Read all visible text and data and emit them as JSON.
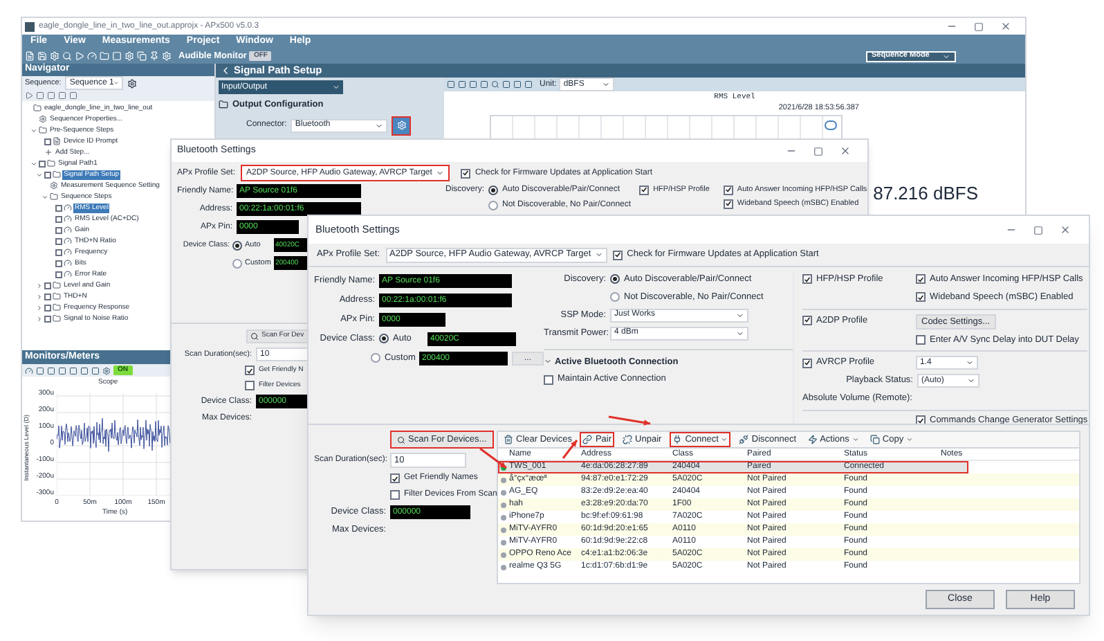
{
  "app": {
    "title": "eagle_dongle_line_in_two_line_out.approjx - APx500 v5.0.3",
    "menu": [
      "File",
      "View",
      "Measurements",
      "Project",
      "Window",
      "Help"
    ],
    "audible_monitor": {
      "label": "Audible Monitor",
      "state": "OFF",
      "on": false
    },
    "mode": "Sequence Mode"
  },
  "navigator": {
    "title": "Navigator",
    "sequence_label": "Sequence:",
    "sequence": "Sequence 1",
    "tree": [
      {
        "label": "eagle_dongle_line_in_two_line_out",
        "kind": "project",
        "selected": false,
        "children": [
          {
            "label": "Sequencer Properties...",
            "kind": "settings",
            "selected": false
          },
          {
            "label": "Pre-Sequence Steps",
            "kind": "folder",
            "selected": false,
            "expanded": true,
            "children": [
              {
                "label": "Device ID Prompt",
                "kind": "prompt",
                "selected": false,
                "checked": false
              },
              {
                "label": "Add Step...",
                "kind": "add",
                "selected": false
              }
            ]
          },
          {
            "label": "Signal Path1",
            "kind": "folder",
            "selected": false,
            "expanded": true,
            "checked": false,
            "children": [
              {
                "label": "Signal Path Setup",
                "kind": "folder",
                "selected": true,
                "expanded": true,
                "checked": false,
                "children": [
                  {
                    "label": "Measurement Sequence Setting",
                    "kind": "settings",
                    "selected": false
                  },
                  {
                    "label": "Sequence Steps",
                    "kind": "folder",
                    "selected": false,
                    "expanded": true,
                    "children": [
                      {
                        "label": "RMS Level",
                        "kind": "meter",
                        "selected": true,
                        "checked": false
                      },
                      {
                        "label": "RMS Level (AC+DC)",
                        "kind": "meter",
                        "selected": false,
                        "checked": false
                      },
                      {
                        "label": "Gain",
                        "kind": "meter",
                        "selected": false,
                        "checked": false
                      },
                      {
                        "label": "THD+N Ratio",
                        "kind": "meter",
                        "selected": false,
                        "checked": false
                      },
                      {
                        "label": "Frequency",
                        "kind": "meter",
                        "selected": false,
                        "checked": false
                      },
                      {
                        "label": "Bits",
                        "kind": "meter",
                        "selected": false,
                        "checked": false
                      },
                      {
                        "label": "Error Rate",
                        "kind": "meter",
                        "selected": false,
                        "checked": false
                      }
                    ]
                  }
                ]
              },
              {
                "label": "Level and Gain",
                "kind": "folder",
                "selected": false,
                "expanded": false,
                "checked": false
              },
              {
                "label": "THD+N",
                "kind": "folder",
                "selected": false,
                "expanded": false,
                "checked": false
              },
              {
                "label": "Frequency Response",
                "kind": "folder",
                "selected": false,
                "expanded": false,
                "checked": false
              },
              {
                "label": "Signal to Noise Ratio",
                "kind": "folder",
                "selected": false,
                "expanded": false,
                "checked": false
              }
            ]
          }
        ]
      }
    ]
  },
  "monitors": {
    "title": "Monitors/Meters",
    "toggle": {
      "state": "ON",
      "on": true
    },
    "scope": {
      "title": "Scope",
      "ylabel": "Instantaneous Level (D)",
      "xlabel": "Time (s)",
      "yticks": [
        "300u",
        "200u",
        "100u",
        "0",
        "-100u",
        "-200u",
        "-300u"
      ],
      "xticks": [
        "0",
        "50m",
        "100m",
        "150m"
      ]
    }
  },
  "signal_path": {
    "title": "Signal Path Setup",
    "tab": "Input/Output",
    "section": "Output Configuration",
    "connector_label": "Connector:",
    "connector": "Bluetooth",
    "settings_annotated": true
  },
  "graph": {
    "unit_label": "Unit:",
    "unit": "dBFS",
    "title": "RMS Level",
    "timestamp": "2021/6/28 18:53:56.387",
    "reading": "87.216 dBFS"
  },
  "dialog_back": {
    "title": "Bluetooth Settings",
    "profile_label": "APx Profile Set:",
    "profile": "A2DP Source, HFP Audio Gateway, AVRCP Target",
    "profile_annotated": true,
    "firmware_check": {
      "label": "Check for Firmware Updates at Application Start",
      "checked": true
    },
    "fields": [
      {
        "label": "Friendly Name:",
        "value": "AP Source 01f6"
      },
      {
        "label": "Address:",
        "value": "00:22:1a:00:01:f6"
      },
      {
        "label": "APx Pin:",
        "value": "0000"
      }
    ],
    "device_class_label": "Device Class:",
    "device_class": [
      {
        "label": "Auto",
        "selected": true,
        "value": "40020C"
      },
      {
        "label": "Custom",
        "selected": false,
        "value": "200400"
      }
    ],
    "discovery_label": "Discovery:",
    "discovery": [
      {
        "label": "Auto Discoverable/Pair/Connect",
        "selected": true
      },
      {
        "label": "Not Discoverable, No Pair/Connect",
        "selected": false
      }
    ],
    "options": [
      {
        "label": "HFP/HSP Profile",
        "checked": true
      },
      {
        "label": "Auto Answer Incoming HFP/HSP Calls",
        "checked": true
      },
      {
        "label": "Wideband Speech (mSBC) Enabled",
        "checked": true
      }
    ],
    "scan_button": "Scan For Dev",
    "scan_duration_label": "Scan Duration(sec):",
    "scan_duration": "10",
    "scan_checks": [
      {
        "label": "Get Friendly N",
        "checked": true
      },
      {
        "label": "Filter Devices",
        "checked": false
      }
    ],
    "scan_class_label": "Device Class:",
    "scan_class": "000000",
    "max_devices_label": "Max Devices:"
  },
  "dialog_front": {
    "title": "Bluetooth Settings",
    "profile_label": "APx Profile Set:",
    "profile": "A2DP Source, HFP Audio Gateway, AVRCP Target",
    "firmware_check": {
      "label": "Check for Firmware Updates at Application Start",
      "checked": true
    },
    "fields": [
      {
        "label": "Friendly Name:",
        "value": "AP Source 01f6"
      },
      {
        "label": "Address:",
        "value": "00:22:1a:00:01:f6"
      },
      {
        "label": "APx Pin:",
        "value": "0000"
      }
    ],
    "device_class_label": "Device Class:",
    "device_class": [
      {
        "label": "Auto",
        "selected": true,
        "value": "40020C"
      },
      {
        "label": "Custom",
        "selected": false,
        "value": "200400"
      }
    ],
    "browse": "...",
    "discovery_label": "Discovery:",
    "discovery": [
      {
        "label": "Auto Discoverable/Pair/Connect",
        "selected": true
      },
      {
        "label": "Not Discoverable, No Pair/Connect",
        "selected": false
      }
    ],
    "ssp_label": "SSP Mode:",
    "ssp": "Just Works",
    "tx_label": "Transmit Power:",
    "tx": "4 dBm",
    "active_connection": {
      "title": "Active Bluetooth Connection",
      "expanded": true
    },
    "maintain": {
      "label": "Maintain Active Connection",
      "checked": false
    },
    "hfp": {
      "label": "HFP/HSP Profile",
      "checked": true
    },
    "auto_answer": {
      "label": "Auto Answer Incoming HFP/HSP Calls",
      "checked": true
    },
    "wideband": {
      "label": "Wideband Speech (mSBC) Enabled",
      "checked": true
    },
    "a2dp": {
      "label": "A2DP Profile",
      "checked": true
    },
    "codec_button": "Codec Settings...",
    "av_sync": {
      "label": "Enter A/V Sync Delay into DUT Delay",
      "checked": false
    },
    "avrcp": {
      "label": "AVRCP Profile",
      "checked": true
    },
    "avrcp_version": "1.4",
    "playback_label": "Playback Status:",
    "playback": "(Auto)",
    "absolute_volume_label": "Absolute Volume (Remote):",
    "commands_change": {
      "label": "Commands Change Generator Settings",
      "checked": true
    },
    "scan_button": {
      "label": "Scan For Devices...",
      "annotated": true
    },
    "scan_duration_label": "Scan Duration(sec):",
    "scan_duration": "10",
    "scan_checks": [
      {
        "label": "Get Friendly Names",
        "checked": true
      },
      {
        "label": "Filter Devices From Scan",
        "checked": false
      }
    ],
    "scan_class_label": "Device Class:",
    "scan_class": "000000",
    "max_devices_label": "Max Devices:",
    "toolbar": [
      {
        "label": "Clear Devices",
        "kind": "clear",
        "annotated": false,
        "menu": false
      },
      {
        "label": "Pair",
        "kind": "pair",
        "annotated": true,
        "menu": false
      },
      {
        "label": "Unpair",
        "kind": "unpair",
        "annotated": false,
        "menu": false
      },
      {
        "label": "Connect",
        "kind": "connect",
        "annotated": true,
        "menu": true
      },
      {
        "label": "Disconnect",
        "kind": "disconnect",
        "annotated": false,
        "menu": false
      },
      {
        "label": "Actions",
        "kind": "actions",
        "annotated": false,
        "menu": true
      },
      {
        "label": "Copy",
        "kind": "copy",
        "annotated": false,
        "menu": true
      }
    ],
    "table": {
      "columns": [
        "Name",
        "Address",
        "Class",
        "Paired",
        "Status",
        "Notes"
      ],
      "rows": [
        {
          "name": "TWS_001",
          "address": "4e:da:06:28:27:89",
          "class": "240404",
          "paired": "Paired",
          "status": "Connected",
          "color": "#22a94a",
          "selected": true,
          "annotated": true
        },
        {
          "name": "å°çx°æœª",
          "address": "94:87:e0:e1:72:29",
          "class": "5A020C",
          "paired": "Not Paired",
          "status": "Found",
          "color": "#9ca3af",
          "selected": false,
          "annotated": false
        },
        {
          "name": "AG_EQ",
          "address": "83:2e:d9:2e:ea:40",
          "class": "240404",
          "paired": "Not Paired",
          "status": "Found",
          "color": "#9ca3af",
          "selected": false,
          "annotated": false
        },
        {
          "name": "hah",
          "address": "e3:28:e9:20:da:70",
          "class": "1F00",
          "paired": "Not Paired",
          "status": "Found",
          "color": "#9ca3af",
          "selected": false,
          "annotated": false
        },
        {
          "name": "iPhone7p",
          "address": "bc:9f:ef:09:61:98",
          "class": "7A020C",
          "paired": "Not Paired",
          "status": "Found",
          "color": "#9ca3af",
          "selected": false,
          "annotated": false
        },
        {
          "name": "MiTV-AYFR0",
          "address": "60:1d:9d:20:e1:65",
          "class": "A0110",
          "paired": "Not Paired",
          "status": "Found",
          "color": "#9ca3af",
          "selected": false,
          "annotated": false
        },
        {
          "name": "MiTV-AYFR0",
          "address": "60:1d:9d:9e:22:c8",
          "class": "A0110",
          "paired": "Not Paired",
          "status": "Found",
          "color": "#9ca3af",
          "selected": false,
          "annotated": false
        },
        {
          "name": "OPPO Reno Ace",
          "address": "c4:e1:a1:b2:06:3e",
          "class": "5A020C",
          "paired": "Not Paired",
          "status": "Found",
          "color": "#9ca3af",
          "selected": false,
          "annotated": false
        },
        {
          "name": "realme Q3 5G",
          "address": "1c:d1:07:6b:d1:9e",
          "class": "5A020C",
          "paired": "Not Paired",
          "status": "Found",
          "color": "#9ca3af",
          "selected": false,
          "annotated": false
        }
      ]
    },
    "buttons": [
      "Close",
      "Help"
    ]
  }
}
